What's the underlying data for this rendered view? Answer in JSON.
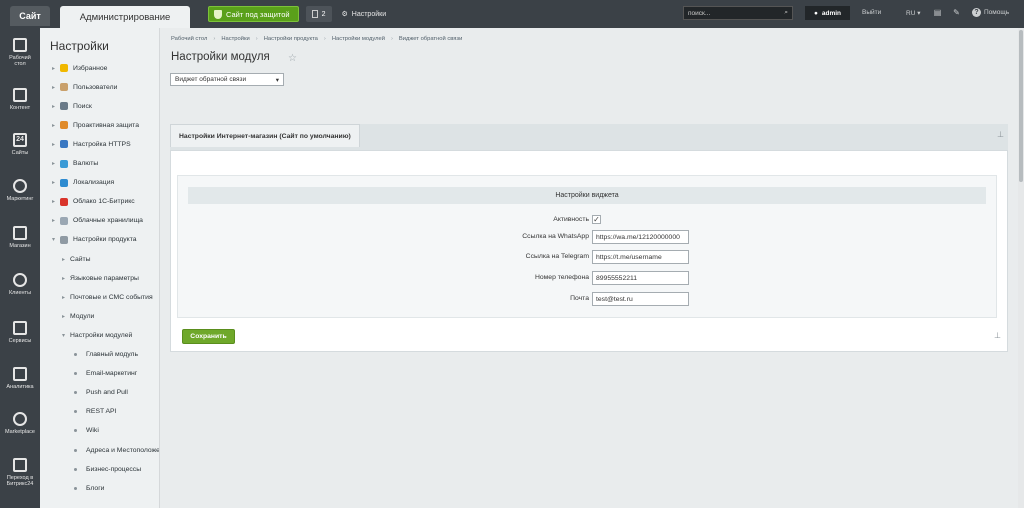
{
  "topbar": {
    "site_tab": "Сайт",
    "admin_tab": "Администрирование",
    "protect_label": "Сайт под защитой",
    "notifications_count": "2",
    "settings_label": "Настройки",
    "search_placeholder": "поиск...",
    "user_name": "admin",
    "logout_label": "Выйти",
    "lang_label": "RU",
    "help_label": "Помощь"
  },
  "leftbar": {
    "items": [
      {
        "label1": "Рабочий",
        "label2": "стол",
        "icon": "home-icon"
      },
      {
        "label1": "Контент",
        "label2": "",
        "icon": "content-icon"
      },
      {
        "label1": "Сайты",
        "label2": "",
        "icon": "calendar-icon",
        "num": "24"
      },
      {
        "label1": "Маркетинг",
        "label2": "",
        "icon": "target-icon"
      },
      {
        "label1": "Магазин",
        "label2": "",
        "icon": "cart-icon"
      },
      {
        "label1": "Клиенты",
        "label2": "",
        "icon": "clients-icon"
      },
      {
        "label1": "Сервисы",
        "label2": "",
        "icon": "layers-icon"
      },
      {
        "label1": "Аналитика",
        "label2": "",
        "icon": "chart-icon"
      },
      {
        "label1": "Marketplace",
        "label2": "",
        "icon": "cloud-icon"
      },
      {
        "label1": "Переход в",
        "label2": "Битрикс24",
        "icon": "magic-icon"
      }
    ]
  },
  "menu": {
    "title": "Настройки",
    "items": [
      {
        "label": "Избранное",
        "level": 0,
        "icon": "star-icon",
        "color": "#f0b800"
      },
      {
        "label": "Пользователи",
        "level": 0,
        "icon": "user-icon",
        "color": "#c9a06b"
      },
      {
        "label": "Поиск",
        "level": 0,
        "icon": "search-icon",
        "color": "#6a7a88"
      },
      {
        "label": "Проактивная защита",
        "level": 0,
        "icon": "shield-icon",
        "color": "#e08b2a"
      },
      {
        "label": "Настройка HTTPS",
        "level": 0,
        "icon": "lock-icon",
        "color": "#3a78c2"
      },
      {
        "label": "Валюты",
        "level": 0,
        "icon": "currency-icon",
        "color": "#3a9ad6"
      },
      {
        "label": "Локализация",
        "level": 0,
        "icon": "globe-icon",
        "color": "#2e8bd0"
      },
      {
        "label": "Облако 1С-Битрикс",
        "level": 0,
        "icon": "cloud-icon",
        "color": "#d9342b"
      },
      {
        "label": "Облачные хранилища",
        "level": 0,
        "icon": "storage-icon",
        "color": "#9aa7b3"
      },
      {
        "label": "Настройки продукта",
        "level": 0,
        "icon": "gear-icon",
        "color": "#8f9aa3"
      },
      {
        "label": "Сайты",
        "level": 1
      },
      {
        "label": "Языковые параметры",
        "level": 1
      },
      {
        "label": "Почтовые и СМС события",
        "level": 1
      },
      {
        "label": "Модули",
        "level": 1
      },
      {
        "label": "Настройки модулей",
        "level": 1
      },
      {
        "label": "Главный модуль",
        "level": 2
      },
      {
        "label": "Email-маркетинг",
        "level": 2
      },
      {
        "label": "Push and Pull",
        "level": 2
      },
      {
        "label": "REST API",
        "level": 2
      },
      {
        "label": "Wiki",
        "level": 2
      },
      {
        "label": "Адреса и Местоположения",
        "level": 2
      },
      {
        "label": "Бизнес-процессы",
        "level": 2
      },
      {
        "label": "Блоги",
        "level": 2
      }
    ]
  },
  "breadcrumbs": [
    "Рабочий стол",
    "Настройки",
    "Настройки продукта",
    "Настройки модулей",
    "Виджет обратной связи"
  ],
  "page": {
    "title": "Настройки модуля",
    "module_select": "Виджет обратной связи",
    "tab_label": "Настройки Интернет-магазин (Сайт по умолчанию)",
    "section_title": "Настройки виджета",
    "fields": {
      "active_label": "Активность",
      "active_checked": "✓",
      "whatsapp_label": "Ссылка на WhatsApp",
      "whatsapp_value": "https://wa.me/12120000000",
      "telegram_label": "Ссылка на Telegram",
      "telegram_value": "https://t.me/username",
      "phone_label": "Номер телефона",
      "phone_value": "89955552211",
      "email_label": "Почта",
      "email_value": "test@test.ru"
    },
    "save_label": "Сохранить"
  }
}
